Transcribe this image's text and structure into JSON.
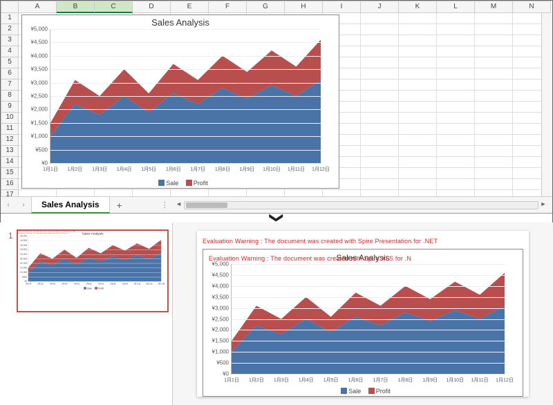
{
  "excel": {
    "columns": [
      "A",
      "B",
      "C",
      "D",
      "E",
      "F",
      "G",
      "H",
      "I",
      "J",
      "K",
      "L",
      "M",
      "N"
    ],
    "selected_columns": [
      "B",
      "C"
    ],
    "row_count": 17,
    "sheet_tab": "Sales Analysis",
    "nav_prev": "‹",
    "nav_next": "›",
    "add_sheet": "+",
    "scroll_left": "◄",
    "scroll_right": "►"
  },
  "connector_glyph": "❯",
  "ppt": {
    "slide_number": "1",
    "warning": "Evaluation Warning : The document was created with  Spire.Presentation for .NET",
    "warning_inner": "Evaluation Warning : The document was created with Spire.XLS for .N"
  },
  "chart_data": {
    "type": "area",
    "stacked": true,
    "title": "Sales Analysis",
    "categories": [
      "1月1日",
      "1月2日",
      "1月3日",
      "1月4日",
      "1月5日",
      "1月6日",
      "1月7日",
      "1月8日",
      "1月9日",
      "1月10日",
      "1月11日",
      "1月12日"
    ],
    "series": [
      {
        "name": "Sale",
        "color": "#4a73a8",
        "values": [
          1000,
          2200,
          1800,
          2500,
          1900,
          2600,
          2200,
          2800,
          2400,
          2900,
          2500,
          3100
        ]
      },
      {
        "name": "Profit",
        "color": "#b84e4e",
        "values": [
          500,
          900,
          700,
          1000,
          700,
          1100,
          900,
          1200,
          1000,
          1300,
          1100,
          1500
        ]
      }
    ],
    "ylabel_prefix": "¥",
    "ylim": [
      0,
      5000
    ],
    "yticks": [
      0,
      500,
      1000,
      1500,
      2000,
      2500,
      3000,
      3500,
      4000,
      4500,
      5000
    ],
    "legend": [
      "Sale",
      "Profit"
    ]
  }
}
